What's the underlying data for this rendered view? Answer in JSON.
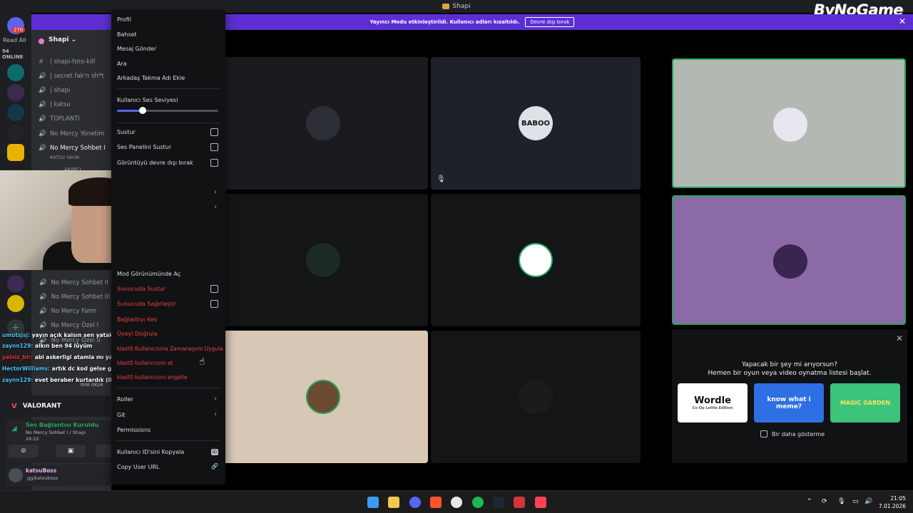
{
  "window": {
    "title": "Shapi"
  },
  "brand": {
    "watermark": "ByNoGame"
  },
  "notice": {
    "text": "Yayıncı Modu etkinleştirildi. Kullanıcı adları kısaltıldı.",
    "button": "Devre dışı bırak"
  },
  "rail": {
    "badge": "270",
    "read_all": "Read All",
    "online": "94 ONLINE"
  },
  "server": {
    "name": "Shapi"
  },
  "channels": [
    {
      "label": "| shapi-foto-kill",
      "kind": "text"
    },
    {
      "label": "| secret fak'n sh*t",
      "kind": "voice"
    },
    {
      "label": "| shapi",
      "kind": "voice"
    },
    {
      "label": "| katsu",
      "kind": "voice"
    },
    {
      "label": "TOPLANTI",
      "kind": "voice"
    },
    {
      "label": "No Mercy Yönetim",
      "kind": "voice"
    },
    {
      "label": "No Mercy Sohbet I",
      "kind": "voice"
    }
  ],
  "channel_sub": {
    "label": "KATSU YAYIN",
    "member": "AKINCI"
  },
  "channels_lower": [
    {
      "label": "No Mercy Sohbet II"
    },
    {
      "label": "No Mercy Sohbet III"
    },
    {
      "label": "No Mercy Farm"
    },
    {
      "label": "No Mercy Özel I"
    },
    {
      "label": "No Mercy Özel II"
    }
  ],
  "chat": [
    {
      "user": "umutsjsj:",
      "text": "yayın açık kalsın sen yatakta yat star'a kas",
      "red": false
    },
    {
      "user": "zaynn129:",
      "text": "alkın ben 94 lüyüm",
      "red": false
    },
    {
      "user": "yalniz_bir:",
      "text": "abi askerligi atamla mı yaptın",
      "red": true
    },
    {
      "user": "HectorWilliams:",
      "text": "artık dc kod gelse girecemde kod gelmiyor aq",
      "red": false
    },
    {
      "user": "zaynn129:",
      "text": "evet beraber kurtardık (likeyi",
      "red": false
    }
  ],
  "chat_tag": "YENİ OKUR",
  "game": {
    "name": "VALORANT"
  },
  "voice": {
    "status": "Ses Bağlantısı Kuruldu",
    "channel": "No Mercy Sohbet I / Shapi",
    "time": "26:22"
  },
  "user": {
    "name": "katsuBoss",
    "sub": ".gg/katsuboss"
  },
  "menu": {
    "items_top": [
      "Profil",
      "Bahset",
      "Mesaj Gönder",
      "Ara",
      "Arkadaş Takma Adı Ekle"
    ],
    "volume_label": "Kullanıcı Ses Seviyesi",
    "volume": 0.25,
    "toggles": [
      "Sustur",
      "Ses Panelini Sustur",
      "Görüntüyü devre dışı bırak"
    ],
    "mod_view": "Mod Görünümünde Aç",
    "server_toggles": [
      "Sunucuda Sustur",
      "Sunucuda Sağırlaştır"
    ],
    "disconnect": "Bağlantıyı Kes",
    "move": "Üyeyi Doğrula",
    "timeout": "klast0 Kullanıcısına Zamanaşımı Uygula",
    "kick": "klast0 kullanıcısını at",
    "ban": "klast0 kullanıcısını engelle",
    "roles": "Roller",
    "git": "Git",
    "permissions": "Permissions",
    "copy_id": "Kullanıcı ID'sini Kopyala",
    "copy_id_icon": "ID",
    "copy_url": "Copy User URL"
  },
  "tiles": [
    {
      "avatar_color": "#2c3036"
    },
    {
      "avatar_color": "#dde2e8",
      "avatar_text": "BABOO"
    },
    {
      "avatar_color": "#e8e6ee"
    },
    {
      "avatar_color": "#1c2a26"
    },
    {
      "avatar_color": "#ffffff"
    },
    {
      "avatar_color": "#3a2450"
    },
    {
      "avatar_color": "#6b4a32"
    },
    {
      "avatar_color": "#1b1b1b"
    }
  ],
  "activity": {
    "question": "Yapacak bir şey mi arıyorsun?",
    "sub": "Hemen bir oyun veya video oynatma listesi başlat.",
    "games": [
      {
        "name": "Wordle",
        "sub": "Co-Op Lottie Edition"
      },
      {
        "name": "know what i meme?"
      },
      {
        "name": "MAGIC GARDEN"
      }
    ],
    "checkbox": "Bir daha gösterme"
  },
  "clock": {
    "time": "21:05",
    "date": "7.01.2026"
  }
}
